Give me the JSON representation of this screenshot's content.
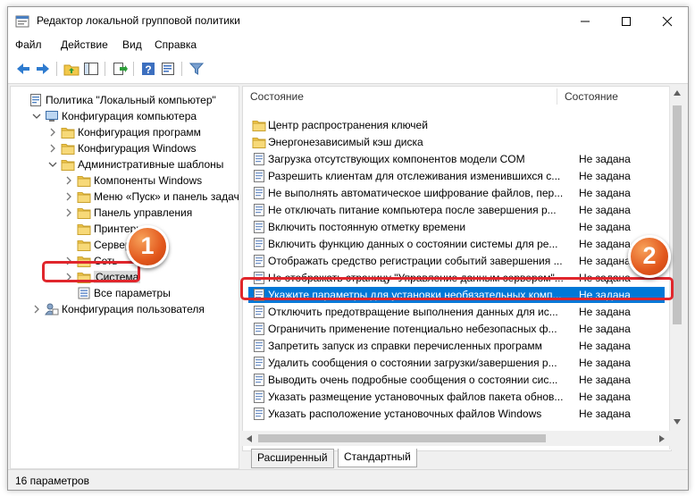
{
  "window": {
    "title": "Редактор локальной групповой политики",
    "buttons": {
      "minimize": "—",
      "maximize": "☐",
      "close": "✕"
    }
  },
  "menu": [
    "Файл",
    "Действие",
    "Вид",
    "Справка"
  ],
  "toolbar_icons": [
    "back-arrow-icon",
    "forward-arrow-icon",
    "folder-up-icon",
    "show-hide-tree-icon",
    "export-list-icon",
    "help-icon",
    "properties-icon",
    "filter-icon"
  ],
  "tree": [
    {
      "label": "Политика \"Локальный компьютер\"",
      "icon": "policy-icon",
      "arrow": "",
      "selected": false
    },
    {
      "label": "Конфигурация компьютера",
      "icon": "computer-icon",
      "arrow": "expanded",
      "selected": false
    },
    {
      "label": "Конфигурация программ",
      "icon": "folder-icon",
      "arrow": "collapsed",
      "selected": false
    },
    {
      "label": "Конфигурация Windows",
      "icon": "folder-icon",
      "arrow": "collapsed",
      "selected": false
    },
    {
      "label": "Административные шаблоны",
      "icon": "folder-icon",
      "arrow": "expanded",
      "selected": false
    },
    {
      "label": "Компоненты Windows",
      "icon": "folder-icon",
      "arrow": "collapsed",
      "selected": false
    },
    {
      "label": "Меню «Пуск» и панель задач",
      "icon": "folder-icon",
      "arrow": "collapsed",
      "selected": false
    },
    {
      "label": "Панель управления",
      "icon": "folder-icon",
      "arrow": "collapsed",
      "selected": false
    },
    {
      "label": "Принтеры",
      "icon": "folder-icon",
      "arrow": "",
      "selected": false
    },
    {
      "label": "Сервер",
      "icon": "folder-icon",
      "arrow": "",
      "selected": false
    },
    {
      "label": "Сеть",
      "icon": "folder-icon",
      "arrow": "collapsed",
      "selected": false
    },
    {
      "label": "Система",
      "icon": "folder-icon",
      "arrow": "collapsed",
      "selected": true
    },
    {
      "label": "Все параметры",
      "icon": "settings-list-icon",
      "arrow": "",
      "selected": false
    },
    {
      "label": "Конфигурация пользователя",
      "icon": "user-config-icon",
      "arrow": "collapsed",
      "selected": false
    }
  ],
  "columns": {
    "name": "Состояние",
    "state": "Состояние"
  },
  "rows": [
    {
      "name": "Центр распространения ключей",
      "state": "",
      "icon": "folder-icon",
      "selected": false
    },
    {
      "name": "Энергонезависимый кэш диска",
      "state": "",
      "icon": "folder-icon",
      "selected": false
    },
    {
      "name": "Загрузка отсутствующих компонентов модели COM",
      "state": "Не задана",
      "icon": "policy-setting-icon",
      "selected": false
    },
    {
      "name": "Разрешить клиентам для отслеживания изменившихся с...",
      "state": "Не задана",
      "icon": "policy-setting-icon",
      "selected": false
    },
    {
      "name": "Не выполнять автоматическое шифрование файлов, пер...",
      "state": "Не задана",
      "icon": "policy-setting-icon",
      "selected": false
    },
    {
      "name": "Не отключать питание компьютера после завершения р...",
      "state": "Не задана",
      "icon": "policy-setting-icon",
      "selected": false
    },
    {
      "name": "Включить постоянную отметку времени",
      "state": "Не задана",
      "icon": "policy-setting-icon",
      "selected": false
    },
    {
      "name": "Включить функцию данных о состоянии системы для ре...",
      "state": "Не задана",
      "icon": "policy-setting-icon",
      "selected": false
    },
    {
      "name": "Отображать средство регистрации событий завершения ...",
      "state": "Не задана",
      "icon": "policy-setting-icon",
      "selected": false
    },
    {
      "name": "Не отображать страницу \"Управление данным сервером\"...",
      "state": "Не задана",
      "icon": "policy-setting-icon",
      "selected": false
    },
    {
      "name": "Укажите параметры для установки необязательных комп...",
      "state": "Не задана",
      "icon": "policy-setting-icon",
      "selected": true
    },
    {
      "name": "Отключить предотвращение выполнения данных для ис...",
      "state": "Не задана",
      "icon": "policy-setting-icon",
      "selected": false
    },
    {
      "name": "Ограничить применение потенциально небезопасных ф...",
      "state": "Не задана",
      "icon": "policy-setting-icon",
      "selected": false
    },
    {
      "name": "Запретить запуск из справки перечисленных программ",
      "state": "Не задана",
      "icon": "policy-setting-icon",
      "selected": false
    },
    {
      "name": "Удалить сообщения о состоянии загрузки/завершения р...",
      "state": "Не задана",
      "icon": "policy-setting-icon",
      "selected": false
    },
    {
      "name": "Выводить очень подробные сообщения о состоянии сис...",
      "state": "Не задана",
      "icon": "policy-setting-icon",
      "selected": false
    },
    {
      "name": "Указать размещение установочных файлов пакета обнов...",
      "state": "Не задана",
      "icon": "policy-setting-icon",
      "selected": false
    },
    {
      "name": "Указать расположение установочных файлов Windows",
      "state": "Не задана",
      "icon": "policy-setting-icon",
      "selected": false
    }
  ],
  "tabs": [
    {
      "label": "Расширенный",
      "active": false
    },
    {
      "label": "Стандартный",
      "active": true
    }
  ],
  "status": "16 параметров",
  "annotations": {
    "badge1": "1",
    "badge2": "2"
  },
  "colors": {
    "selection": "#0078d7",
    "highlight": "#e0262c",
    "badge": "#e2571c",
    "folder": "#f2c84b"
  }
}
